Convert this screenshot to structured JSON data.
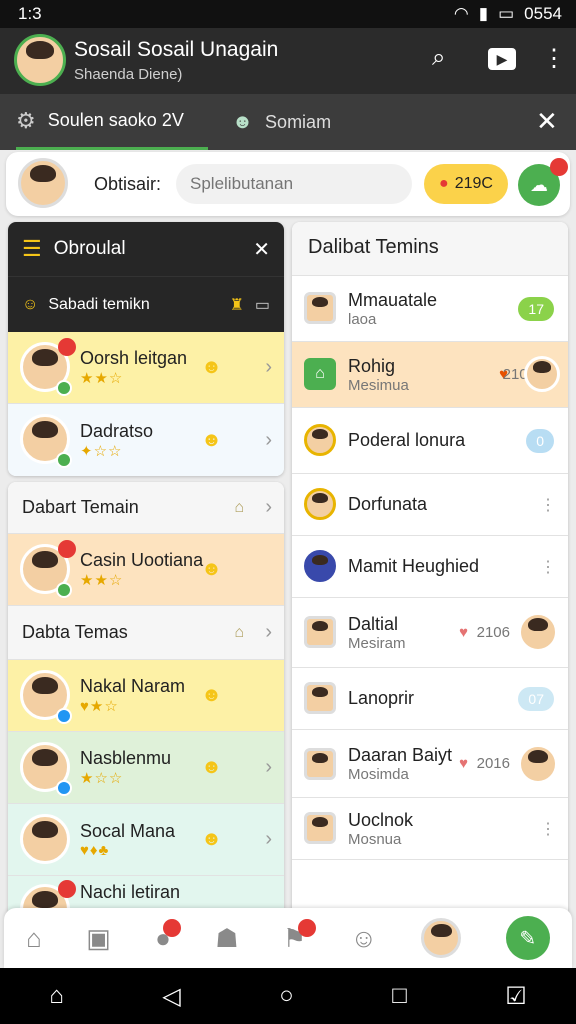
{
  "status": {
    "time": "1:3",
    "right": "0554"
  },
  "appbar": {
    "title": "Sosail Sosail Unagain",
    "subtitle": "Shaenda Diene)"
  },
  "tabs": [
    {
      "label": "Soulen saoko 2V"
    },
    {
      "label": "Somiam"
    }
  ],
  "search": {
    "label": "Obtisair:",
    "placeholder": "Splelibutanan",
    "coin": "219C"
  },
  "left": {
    "panel_title": "Obroulal",
    "panel_sub": "Sabadi temikn",
    "friends": [
      {
        "name": "Oorsh leitgan",
        "stars": "★★☆"
      },
      {
        "name": "Dadratso",
        "stars": "✦☆☆"
      }
    ],
    "section1": "Dabart Temain",
    "friend3": {
      "name": "Casin Uootiana",
      "stars": "★★☆"
    },
    "section2": "Dabta Temas",
    "list": [
      {
        "name": "Nakal Naram",
        "stars": "♥★☆"
      },
      {
        "name": "Nasblenmu",
        "stars": "★☆☆"
      },
      {
        "name": "Socal Mana",
        "stars": "♥♦♣"
      },
      {
        "name": "Nachi letiran",
        "stars": ""
      }
    ]
  },
  "right": {
    "title": "Dalibat Temins",
    "rows": [
      {
        "name": "Mmauatale",
        "sub": "laoa",
        "pill": "17"
      },
      {
        "name": "Rohig",
        "sub": "Mesimua",
        "count": "2106"
      },
      {
        "name": "Poderal lonura",
        "sub": "",
        "pill": "0"
      },
      {
        "name": "Dorfunata",
        "sub": ""
      },
      {
        "name": "Mamit Heughied",
        "sub": ""
      },
      {
        "name": "Daltial",
        "sub": "Mesiram",
        "count": "2106"
      },
      {
        "name": "Lanoprir",
        "sub": "",
        "pill": "07"
      },
      {
        "name": "Daaran Baiyt",
        "sub": "Mosimda",
        "count": "2016"
      },
      {
        "name": "Uoclnok",
        "sub": "Mosnua"
      }
    ]
  },
  "colors": {
    "accent": "#4caf50",
    "yellow": "#fdf1a6",
    "peach": "#fde3bf",
    "green": "#dff1d9",
    "mint": "#e2f6ee",
    "dark": "#262626"
  }
}
